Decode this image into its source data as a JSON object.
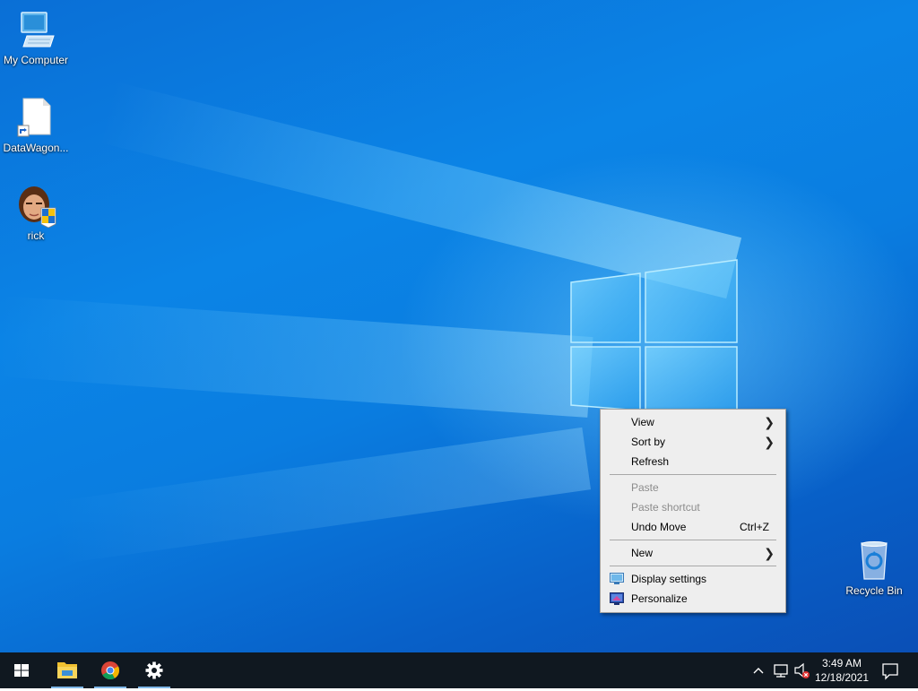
{
  "desktop": {
    "icons": [
      {
        "label": "My Computer"
      },
      {
        "label": "DataWagon..."
      },
      {
        "label": "rick"
      },
      {
        "label": "Recycle Bin"
      }
    ]
  },
  "context_menu": {
    "items": [
      {
        "label": "View",
        "submenu": true,
        "enabled": true
      },
      {
        "label": "Sort by",
        "submenu": true,
        "enabled": true
      },
      {
        "label": "Refresh",
        "enabled": true
      },
      {
        "label": "Paste",
        "enabled": false
      },
      {
        "label": "Paste shortcut",
        "enabled": false
      },
      {
        "label": "Undo Move",
        "shortcut": "Ctrl+Z",
        "enabled": true
      },
      {
        "label": "New",
        "submenu": true,
        "enabled": true
      },
      {
        "label": "Display settings",
        "icon": "display-settings-icon",
        "enabled": true
      },
      {
        "label": "Personalize",
        "icon": "personalize-icon",
        "enabled": true
      }
    ]
  },
  "taskbar": {
    "pinned": [
      {
        "icon": "start-windows-icon"
      },
      {
        "icon": "file-explorer-icon"
      },
      {
        "icon": "chrome-icon"
      },
      {
        "icon": "settings-gear-icon"
      }
    ],
    "tray": {
      "icons": [
        "chevron-up-icon",
        "network-icon",
        "volume-muted-icon",
        "notification-icon"
      ],
      "time": "3:49 AM",
      "date": "12/18/2021"
    }
  },
  "colors": {
    "desktop_blue": "#0a7de0",
    "taskbar": "#101820",
    "menu_bg": "#eeeeee",
    "disabled_text": "#8c8c8c"
  }
}
